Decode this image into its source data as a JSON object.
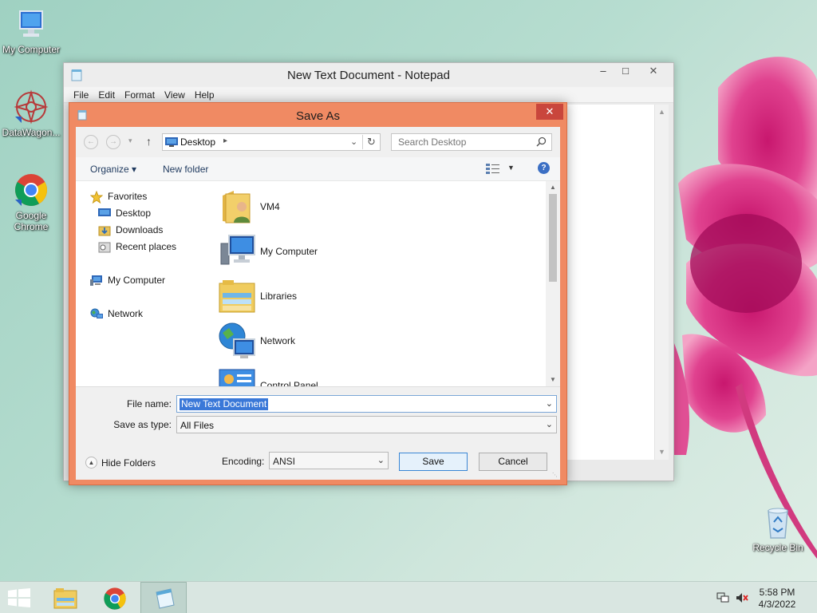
{
  "desktop": {
    "icons": [
      {
        "label": "My Computer"
      },
      {
        "label": "DataWagon..."
      },
      {
        "label": "Google Chrome"
      },
      {
        "label": "Recycle Bin"
      }
    ]
  },
  "notepad": {
    "title": "New Text Document - Notepad",
    "controls": {
      "minimize": "–",
      "maximize": "□",
      "close": "✕"
    },
    "menu": [
      "File",
      "Edit",
      "Format",
      "View",
      "Help"
    ]
  },
  "dialog": {
    "title": "Save As",
    "close": "✕",
    "address": {
      "location": "Desktop"
    },
    "search": {
      "placeholder": "Search Desktop"
    },
    "toolbar": {
      "organize": "Organize ▾",
      "new_folder": "New folder",
      "help": "?"
    },
    "nav_pane": [
      {
        "label": "Favorites",
        "icon": "star-icon"
      },
      {
        "label": "Desktop",
        "icon": "desktop-icon"
      },
      {
        "label": "Downloads",
        "icon": "downloads-icon"
      },
      {
        "label": "Recent places",
        "icon": "recent-places-icon"
      },
      {
        "label": "My Computer",
        "icon": "computer-icon"
      },
      {
        "label": "Network",
        "icon": "network-icon"
      }
    ],
    "files": [
      {
        "label": "VM4",
        "icon": "user-folder-icon"
      },
      {
        "label": "My Computer",
        "icon": "computer-icon"
      },
      {
        "label": "Libraries",
        "icon": "libraries-icon"
      },
      {
        "label": "Network",
        "icon": "network-icon"
      },
      {
        "label": "Control Panel",
        "icon": "control-panel-icon"
      }
    ],
    "file_name": {
      "label": "File name:",
      "value": "New Text Document"
    },
    "save_type": {
      "label": "Save as type:",
      "value": "All Files"
    },
    "hide_folders": "Hide Folders",
    "encoding": {
      "label": "Encoding:",
      "value": "ANSI"
    },
    "buttons": {
      "save": "Save",
      "cancel": "Cancel"
    }
  },
  "taskbar": {
    "clock": {
      "time": "5:58 PM",
      "date": "4/3/2022"
    }
  },
  "colors": {
    "dialog_frame": "#f08a63",
    "close_button": "#c9463c",
    "selection": "#3a78d8",
    "taskbar": "#d9e6e1"
  }
}
